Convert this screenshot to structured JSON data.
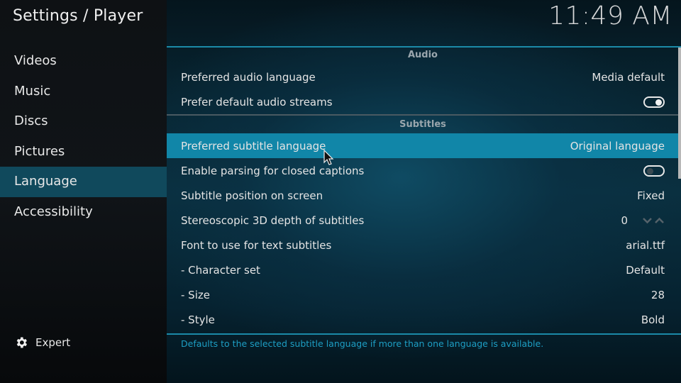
{
  "header": {
    "title": "Settings / Player",
    "clock": "11:49 AM"
  },
  "sidebar": {
    "items": [
      {
        "label": "Videos",
        "active": false
      },
      {
        "label": "Music",
        "active": false
      },
      {
        "label": "Discs",
        "active": false
      },
      {
        "label": "Pictures",
        "active": false
      },
      {
        "label": "Language",
        "active": true
      },
      {
        "label": "Accessibility",
        "active": false
      }
    ],
    "expert": {
      "label": "Expert",
      "icon": "gear-icon"
    }
  },
  "groups": {
    "audio": {
      "title": "Audio",
      "preferred_language": {
        "label": "Preferred audio language",
        "value": "Media default"
      },
      "prefer_default_streams": {
        "label": "Prefer default audio streams",
        "value": "on"
      }
    },
    "subtitles": {
      "title": "Subtitles",
      "preferred_language": {
        "label": "Preferred subtitle language",
        "value": "Original language",
        "selected": true
      },
      "closed_captions": {
        "label": "Enable parsing for closed captions",
        "value": "off"
      },
      "position": {
        "label": "Subtitle position on screen",
        "value": "Fixed"
      },
      "stereo_depth": {
        "label": "Stereoscopic 3D depth of subtitles",
        "value": "0"
      },
      "font": {
        "label": "Font to use for text subtitles",
        "value": "arial.ttf"
      },
      "charset": {
        "label": "- Character set",
        "value": "Default"
      },
      "size": {
        "label": "- Size",
        "value": "28"
      },
      "style": {
        "label": "- Style",
        "value": "Bold"
      }
    }
  },
  "description": "Defaults to the selected subtitle language if more than one language is available.",
  "colors": {
    "accent": "#1186a8",
    "sidebar_active": "#10495c",
    "description_text": "#1d9ec4"
  }
}
